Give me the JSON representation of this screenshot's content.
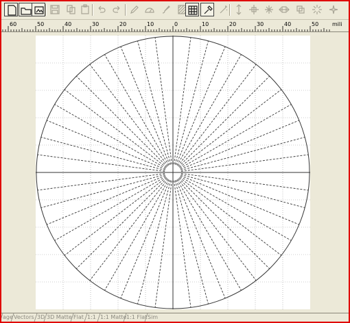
{
  "toolbar": {
    "buttons": [
      {
        "name": "new-document-icon",
        "active": true
      },
      {
        "name": "open-folder-icon",
        "active": true
      },
      {
        "name": "image-icon",
        "active": true
      },
      {
        "name": "save-icon",
        "active": false
      },
      {
        "name": "copy-icon",
        "active": false
      },
      {
        "name": "paste-icon",
        "active": false
      },
      {
        "name": "undo-icon",
        "active": false
      },
      {
        "name": "redo-icon",
        "active": false
      },
      {
        "name": "pen-tool-icon",
        "active": false
      },
      {
        "name": "protractor-icon",
        "active": false
      },
      {
        "name": "brush-icon",
        "active": false
      },
      {
        "name": "pattern-fill-icon",
        "active": false
      },
      {
        "name": "grid-view-icon",
        "active": true
      },
      {
        "name": "eyedropper-icon",
        "active": true
      },
      {
        "name": "wizard-icon",
        "active": false
      },
      {
        "name": "vertical-arrows-icon",
        "active": false
      },
      {
        "name": "crosshair-icon",
        "active": false
      },
      {
        "name": "expand-icon",
        "active": false
      },
      {
        "name": "horizontal-arrows-icon",
        "active": false
      },
      {
        "name": "transform-icon",
        "active": false
      },
      {
        "name": "sparkle-icon",
        "active": false
      },
      {
        "name": "star-burst-icon",
        "active": false
      }
    ]
  },
  "ruler": {
    "unit_label": "mili",
    "tick_labels": [
      "60",
      "50",
      "40",
      "30",
      "20",
      "10",
      "0",
      "10",
      "20",
      "30",
      "40",
      "50"
    ]
  },
  "canvas": {
    "line_style": "dashed",
    "ray_count": 48
  },
  "tabs": [
    {
      "label": "age"
    },
    {
      "label": "Vectors"
    },
    {
      "label": "3D"
    },
    {
      "label": "3D Matte"
    },
    {
      "label": "Flat"
    },
    {
      "label": "1:1"
    },
    {
      "label": "1:1 Matte"
    },
    {
      "label": "1:1 Flat"
    },
    {
      "label": "Sim"
    }
  ]
}
